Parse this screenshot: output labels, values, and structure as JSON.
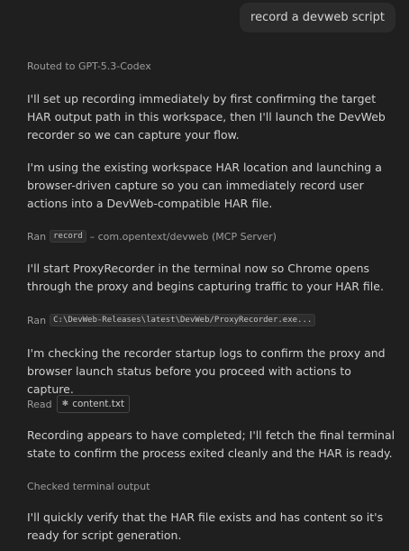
{
  "user_message": "record a devweb script",
  "routed_label": "Routed to GPT-5.3-Codex",
  "paragraphs": [
    "I'll set up recording immediately by first confirming the target HAR output path in this workspace, then I'll launch the DevWeb recorder so we can capture your flow.",
    "I'm using the existing workspace HAR location and launching a browser-driven capture so you can immediately record user actions into a DevWeb-compatible HAR file.",
    "I'll start ProxyRecorder in the terminal now so Chrome opens through the proxy and begins capturing traffic to your HAR file.",
    "I'm checking the recorder startup logs to confirm the proxy and browser launch status before you proceed with actions to capture.",
    "Recording appears to have completed; I'll fetch the final terminal state to confirm the process exited cleanly and the HAR is ready.",
    "I'll quickly verify that the HAR file exists and has content so it's ready for script generation."
  ],
  "tools": {
    "ran_record": {
      "verb": "Ran",
      "code": "record",
      "suffix": "– com.opentext/devweb (MCP Server)"
    },
    "ran_proxy": {
      "verb": "Ran",
      "code": "C:\\DevWeb-Releases\\latest\\DevWeb/ProxyRecorder.exe..."
    },
    "read_file": {
      "verb": "Read",
      "icon": "asterisk-file-icon",
      "file": "content.txt"
    },
    "checked": {
      "text": "Checked terminal output"
    }
  }
}
